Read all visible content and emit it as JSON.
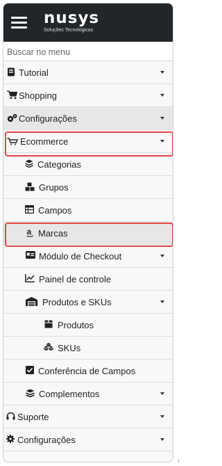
{
  "brand": {
    "name": "nusys",
    "tagline": "Soluções Tecnológicas"
  },
  "search": {
    "placeholder": "Buscar no menu"
  },
  "menu": [
    {
      "label": "Tutorial",
      "icon": "book-icon",
      "has_caret": true
    },
    {
      "label": "Shopping",
      "icon": "cart-icon",
      "has_caret": true
    },
    {
      "label": "Configurações",
      "icon": "cogs-icon",
      "has_caret": true,
      "highlighted": true
    },
    {
      "label": "Ecommerce",
      "icon": "cart-outline-icon",
      "has_caret": true,
      "boxed": true,
      "children": [
        {
          "label": "Categorias",
          "icon": "layers-icon"
        },
        {
          "label": "Grupos",
          "icon": "boxes-icon"
        },
        {
          "label": "Campos",
          "icon": "table-icon"
        },
        {
          "label": "Marcas",
          "icon": "amazon-icon",
          "selected": true,
          "boxed": true
        },
        {
          "label": "Módulo de Checkout",
          "icon": "id-card-icon",
          "has_caret": true
        },
        {
          "label": "Painel de controle",
          "icon": "chart-line-icon"
        },
        {
          "label": "Produtos e SKUs",
          "icon": "warehouse-icon",
          "has_caret": true,
          "children": [
            {
              "label": "Produtos",
              "icon": "box-icon"
            },
            {
              "label": "SKUs",
              "icon": "cubes-icon"
            }
          ]
        },
        {
          "label": "Conferência de Campos",
          "icon": "check-square-icon"
        },
        {
          "label": "Complementos",
          "icon": "layers-icon",
          "has_caret": true
        }
      ]
    },
    {
      "label": "Suporte",
      "icon": "headset-icon",
      "has_caret": true
    },
    {
      "label": "Configurações",
      "icon": "cog-icon",
      "has_caret": true
    }
  ],
  "colors": {
    "topbar": "#222629",
    "highlight_border": "#e0484b",
    "hover_bg": "#e7e7e7"
  }
}
